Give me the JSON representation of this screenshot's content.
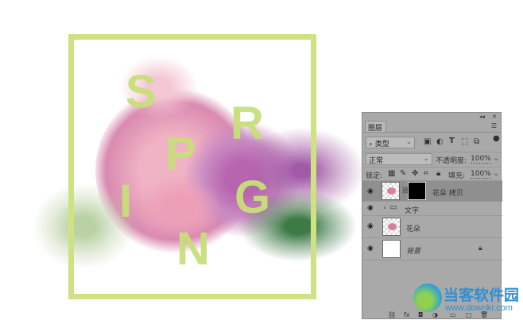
{
  "artwork": {
    "letters": [
      "S",
      "P",
      "R",
      "I",
      "N",
      "G"
    ],
    "frame_color": "#cfe283",
    "letter_color": "#c9df7a"
  },
  "panel": {
    "tab": "图层",
    "filter": {
      "value": "类型"
    },
    "blend": {
      "value": "正常"
    },
    "opacity": {
      "label": "不透明度:",
      "value": "100%"
    },
    "lock": {
      "label": "锁定:"
    },
    "fill": {
      "label": "填充:",
      "value": "100%"
    },
    "layers": [
      {
        "name": "花朵 拷贝",
        "selected": true
      },
      {
        "name": "文字",
        "type": "group"
      },
      {
        "name": "花朵"
      },
      {
        "name": "背景",
        "locked": true
      }
    ]
  },
  "watermark": {
    "title": "当客软件园",
    "url": "www.downkr.com"
  }
}
